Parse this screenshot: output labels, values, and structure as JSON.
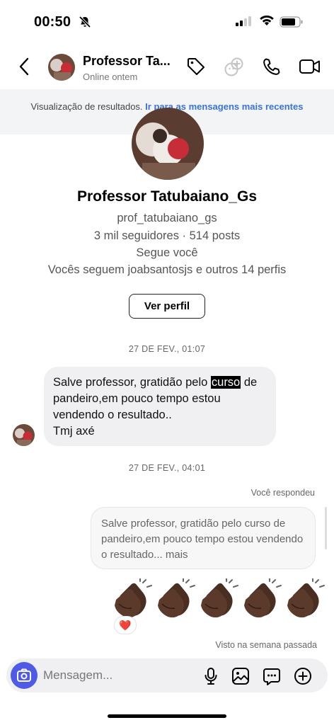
{
  "status_bar": {
    "time": "00:50"
  },
  "header": {
    "name": "Professor Ta...",
    "status": "Online ontem",
    "icons": [
      "back-chevron-icon",
      "tag-icon",
      "ai-sticker-icon",
      "phone-icon",
      "video-camera-icon"
    ]
  },
  "banner": {
    "text": "Visualização de resultados.",
    "link": "Ir para as mensagens mais recentes"
  },
  "profile": {
    "name": "Professor Tatubaiano_Gs",
    "username": "prof_tatubaiano_gs",
    "stats": "3 mil seguidores · 514 posts",
    "follows_you": "Segue você",
    "mutuals": "Vocês seguem joabsantosjs e outros 14 perfis",
    "button_label": "Ver perfil"
  },
  "messages": {
    "date1": "27 DE FEV., 01:07",
    "incoming": {
      "part1": "Salve professor, gratidão pelo ",
      "highlight": "curso",
      "part2": "de pandeiro,em pouco tempo estou vendendo o resultado..",
      "line3": "Tmj axé"
    },
    "date2": "27 DE FEV., 04:01",
    "you_replied": "Você respondeu",
    "quoted": "Salve professor, gratidão pelo curso de pandeiro,em pouco tempo estou vendendo o resultado... mais",
    "reply_emoji": "👏🏿👏🏿👏🏿👏🏿👏🏿",
    "reaction": "❤️",
    "seen": "Visto na semana passada"
  },
  "composer": {
    "placeholder": "Mensagem...",
    "icons": [
      "camera-icon",
      "microphone-icon",
      "gallery-icon",
      "sticker-icon",
      "plus-icon"
    ]
  },
  "colors": {
    "accent": "#4f5be6",
    "link": "#3a73d8",
    "bubble": "#f0f0f2",
    "banner_bg": "#f3f4f6"
  }
}
